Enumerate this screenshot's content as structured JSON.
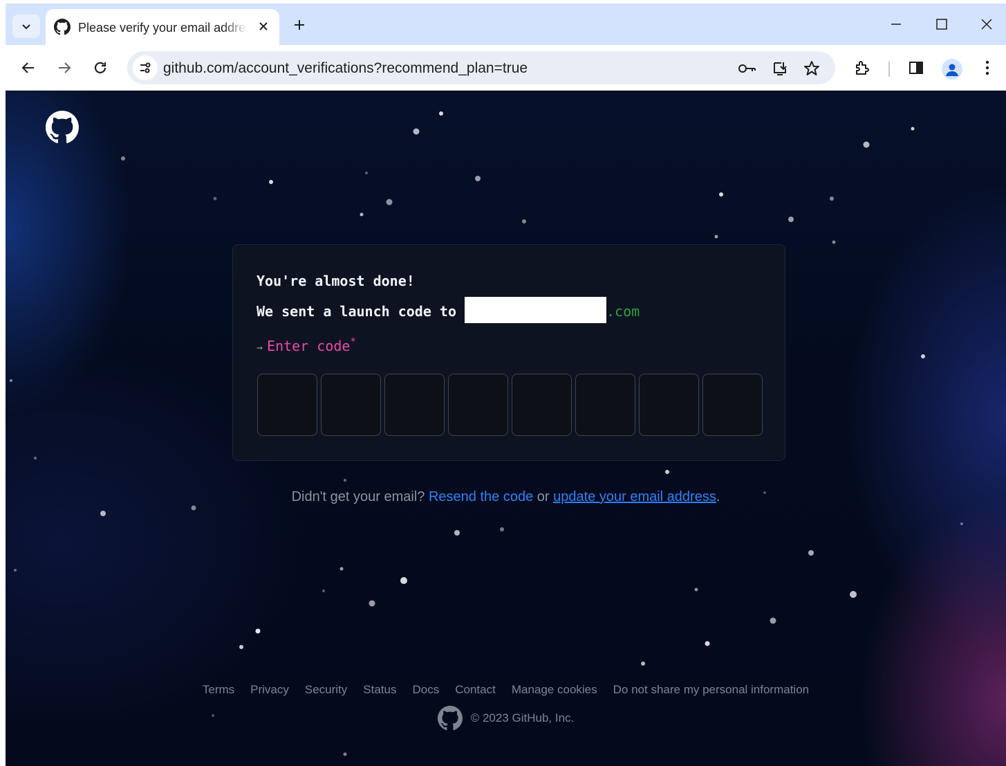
{
  "browser": {
    "tab": {
      "title": "Please verify your email address",
      "favicon": "github-icon"
    },
    "url": "github.com/account_verifications?recommend_plan=true",
    "icons": [
      "tab-search-icon",
      "close-icon",
      "plus-icon",
      "minimize-icon",
      "maximize-icon",
      "window-close-icon",
      "back-icon",
      "forward-icon",
      "reload-icon",
      "site-info-icon",
      "password-key-icon",
      "install-app-icon",
      "bookmark-star-icon",
      "extensions-icon",
      "side-panel-icon",
      "profile-icon",
      "menu-icon"
    ]
  },
  "page": {
    "heading": "You're almost done!",
    "sent_text": "We sent a launch code to",
    "email_suffix": ".com",
    "enter_code_arrow": "→",
    "enter_code_label": "Enter code",
    "required_mark": "*",
    "code_boxes": 8,
    "resend": {
      "prefix": "Didn't get your email?",
      "resend_link": "Resend the code",
      "or": "or",
      "update_link": "update your email address",
      "suffix": "."
    }
  },
  "footer": {
    "links": [
      "Terms",
      "Privacy",
      "Security",
      "Status",
      "Docs",
      "Contact",
      "Manage cookies",
      "Do not share my personal information"
    ],
    "copyright": "© 2023 GitHub, Inc."
  },
  "colors": {
    "page_bg": "#040b1f",
    "accent_pink": "#ea4aaa",
    "link_blue": "#2f81f7",
    "email_green": "#2ea043"
  }
}
